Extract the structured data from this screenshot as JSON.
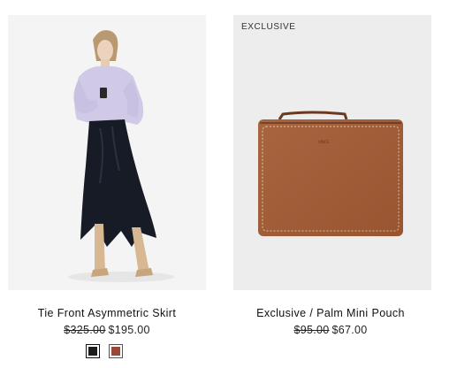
{
  "products": [
    {
      "title": "Tie Front Asymmetric Skirt",
      "original_price": "$325.00",
      "sale_price": "$195.00",
      "swatches": [
        {
          "name": "black",
          "color": "#1c1c1c"
        },
        {
          "name": "rust",
          "color": "#9a4736"
        }
      ]
    },
    {
      "badge": "EXCLUSIVE",
      "title": "Exclusive / Palm Mini Pouch",
      "original_price": "$95.00",
      "sale_price": "$67.00"
    }
  ],
  "colors": {
    "pouch_leather": "#a35a33",
    "sweater": "#cfc8e6",
    "skirt": "#161b26",
    "boots": "#d8b892"
  }
}
